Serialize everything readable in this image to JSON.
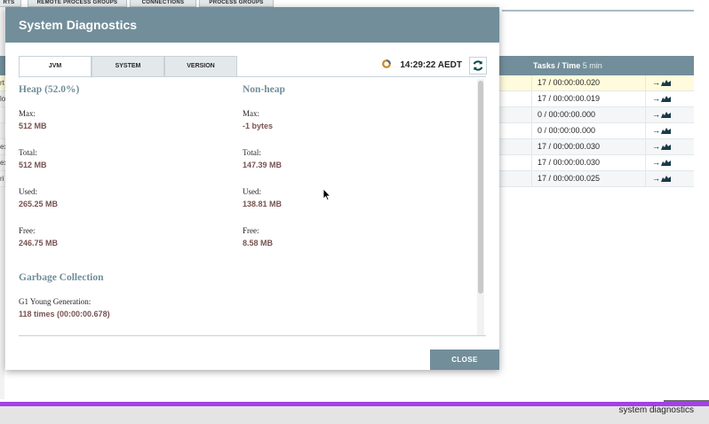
{
  "background": {
    "tabs": [
      "RTS",
      "REMOTE PROCESS GROUPS",
      "CONNECTIONS",
      "PROCESS GROUPS"
    ],
    "table_header": {
      "label": "Tasks / Time",
      "muted": "5 min"
    },
    "row_fragments": [
      "rt",
      "lo",
      "",
      "",
      "ex",
      "ex",
      "ri"
    ],
    "rows": [
      {
        "tasks": "17 / 00:00:00.020",
        "selected": true
      },
      {
        "tasks": "17 / 00:00:00.019"
      },
      {
        "tasks": "0 / 00:00:00.000"
      },
      {
        "tasks": "0 / 00:00:00.000"
      },
      {
        "tasks": "17 / 00:00:00.030"
      },
      {
        "tasks": "17 / 00:00:00.030"
      },
      {
        "tasks": "17 / 00:00:00.025"
      }
    ],
    "row_action_glyph": "→",
    "footer_text": "system diagnostics"
  },
  "dialog": {
    "title": "System Diagnostics",
    "tabs": [
      {
        "label": "JVM",
        "active": true
      },
      {
        "label": "SYSTEM"
      },
      {
        "label": "VERSION"
      }
    ],
    "refreshed_time": "14:29:22 AEDT",
    "heap": {
      "title": "Heap (52.0%)",
      "max_label": "Max:",
      "max_value": "512 MB",
      "total_label": "Total:",
      "total_value": "512 MB",
      "used_label": "Used:",
      "used_value": "265.25 MB",
      "free_label": "Free:",
      "free_value": "246.75 MB"
    },
    "nonheap": {
      "title": "Non-heap",
      "max_label": "Max:",
      "max_value": "-1 bytes",
      "total_label": "Total:",
      "total_value": "147.39 MB",
      "used_label": "Used:",
      "used_value": "138.81 MB",
      "free_label": "Free:",
      "free_value": "8.58 MB"
    },
    "gc": {
      "title": "Garbage Collection",
      "name": "G1 Young Generation:",
      "value": "118 times (00:00:00.678)"
    },
    "close_label": "CLOSE"
  },
  "colors": {
    "header": "#728e9b",
    "value_text": "#775351",
    "selected_row": "#fffbdc",
    "footer_accent": "#a341e6"
  }
}
